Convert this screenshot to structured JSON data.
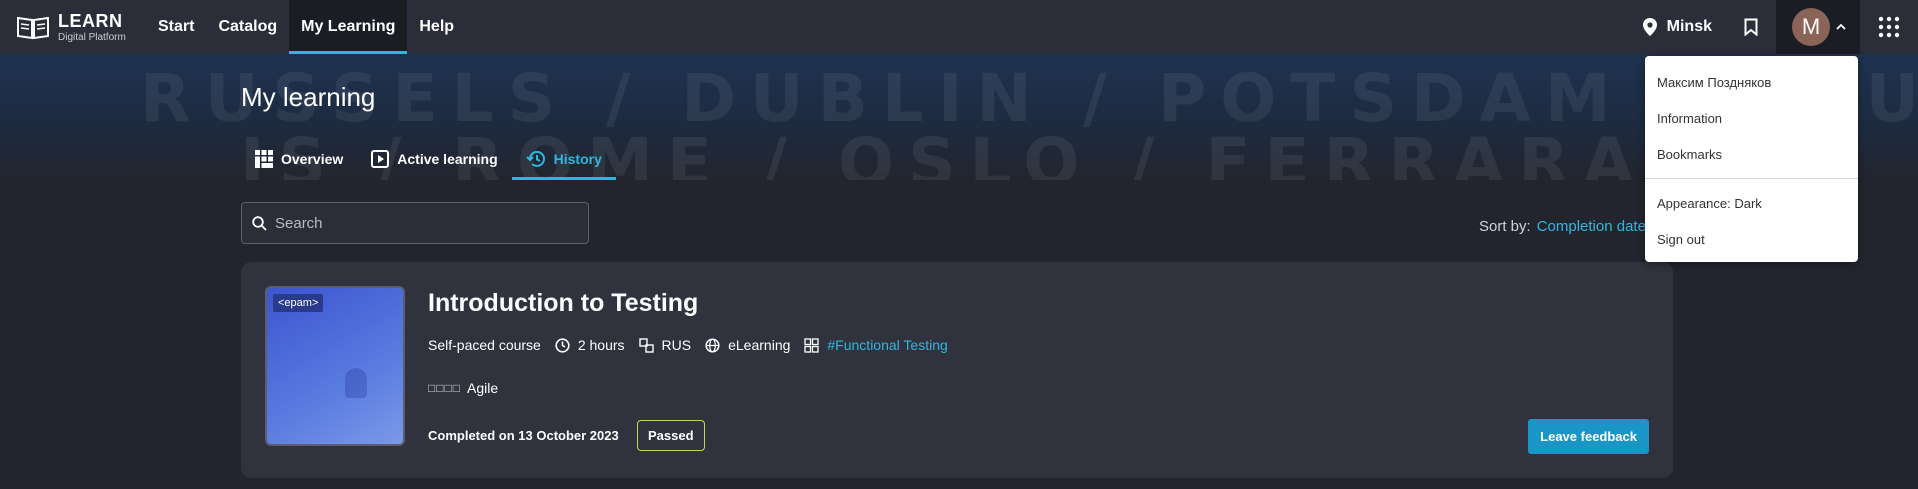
{
  "brand": {
    "title": "LEARN",
    "subtitle": "Digital Platform"
  },
  "nav": {
    "items": [
      {
        "label": "Start"
      },
      {
        "label": "Catalog"
      },
      {
        "label": "My Learning",
        "active": true
      },
      {
        "label": "Help"
      }
    ]
  },
  "header": {
    "location": "Minsk",
    "avatar_initial": "M"
  },
  "hero": {
    "row1": "RUSSELS / DUBLIN / POTSDAM / BRUS",
    "row2": "IS / ROME / OSLO / FERRARA"
  },
  "page": {
    "title": "My learning"
  },
  "tabs": [
    {
      "label": "Overview",
      "icon": "grid-icon"
    },
    {
      "label": "Active learning",
      "icon": "play-icon"
    },
    {
      "label": "History",
      "icon": "history-icon",
      "active": true
    }
  ],
  "search": {
    "placeholder": "Search",
    "value": ""
  },
  "sort": {
    "label": "Sort by:",
    "value": "Completion date"
  },
  "card": {
    "logo": "<epam>",
    "title": "Introduction to Testing",
    "type": "Self-paced course",
    "duration": "2 hours",
    "language": "RUS",
    "format": "eLearning",
    "tag": "#Functional Testing",
    "skill_icon": "□□□□",
    "skill": "Agile",
    "completed": "Completed on 13 October 2023",
    "status": "Passed",
    "feedback_label": "Leave feedback"
  },
  "user_menu": {
    "name": "Максим Поздняков",
    "information": "Information",
    "bookmarks": "Bookmarks",
    "appearance": "Appearance: Dark",
    "sign_out": "Sign out"
  },
  "colors": {
    "accent": "#30b6dd",
    "button": "#1a96c6",
    "badge_border": "#c8d35a"
  }
}
